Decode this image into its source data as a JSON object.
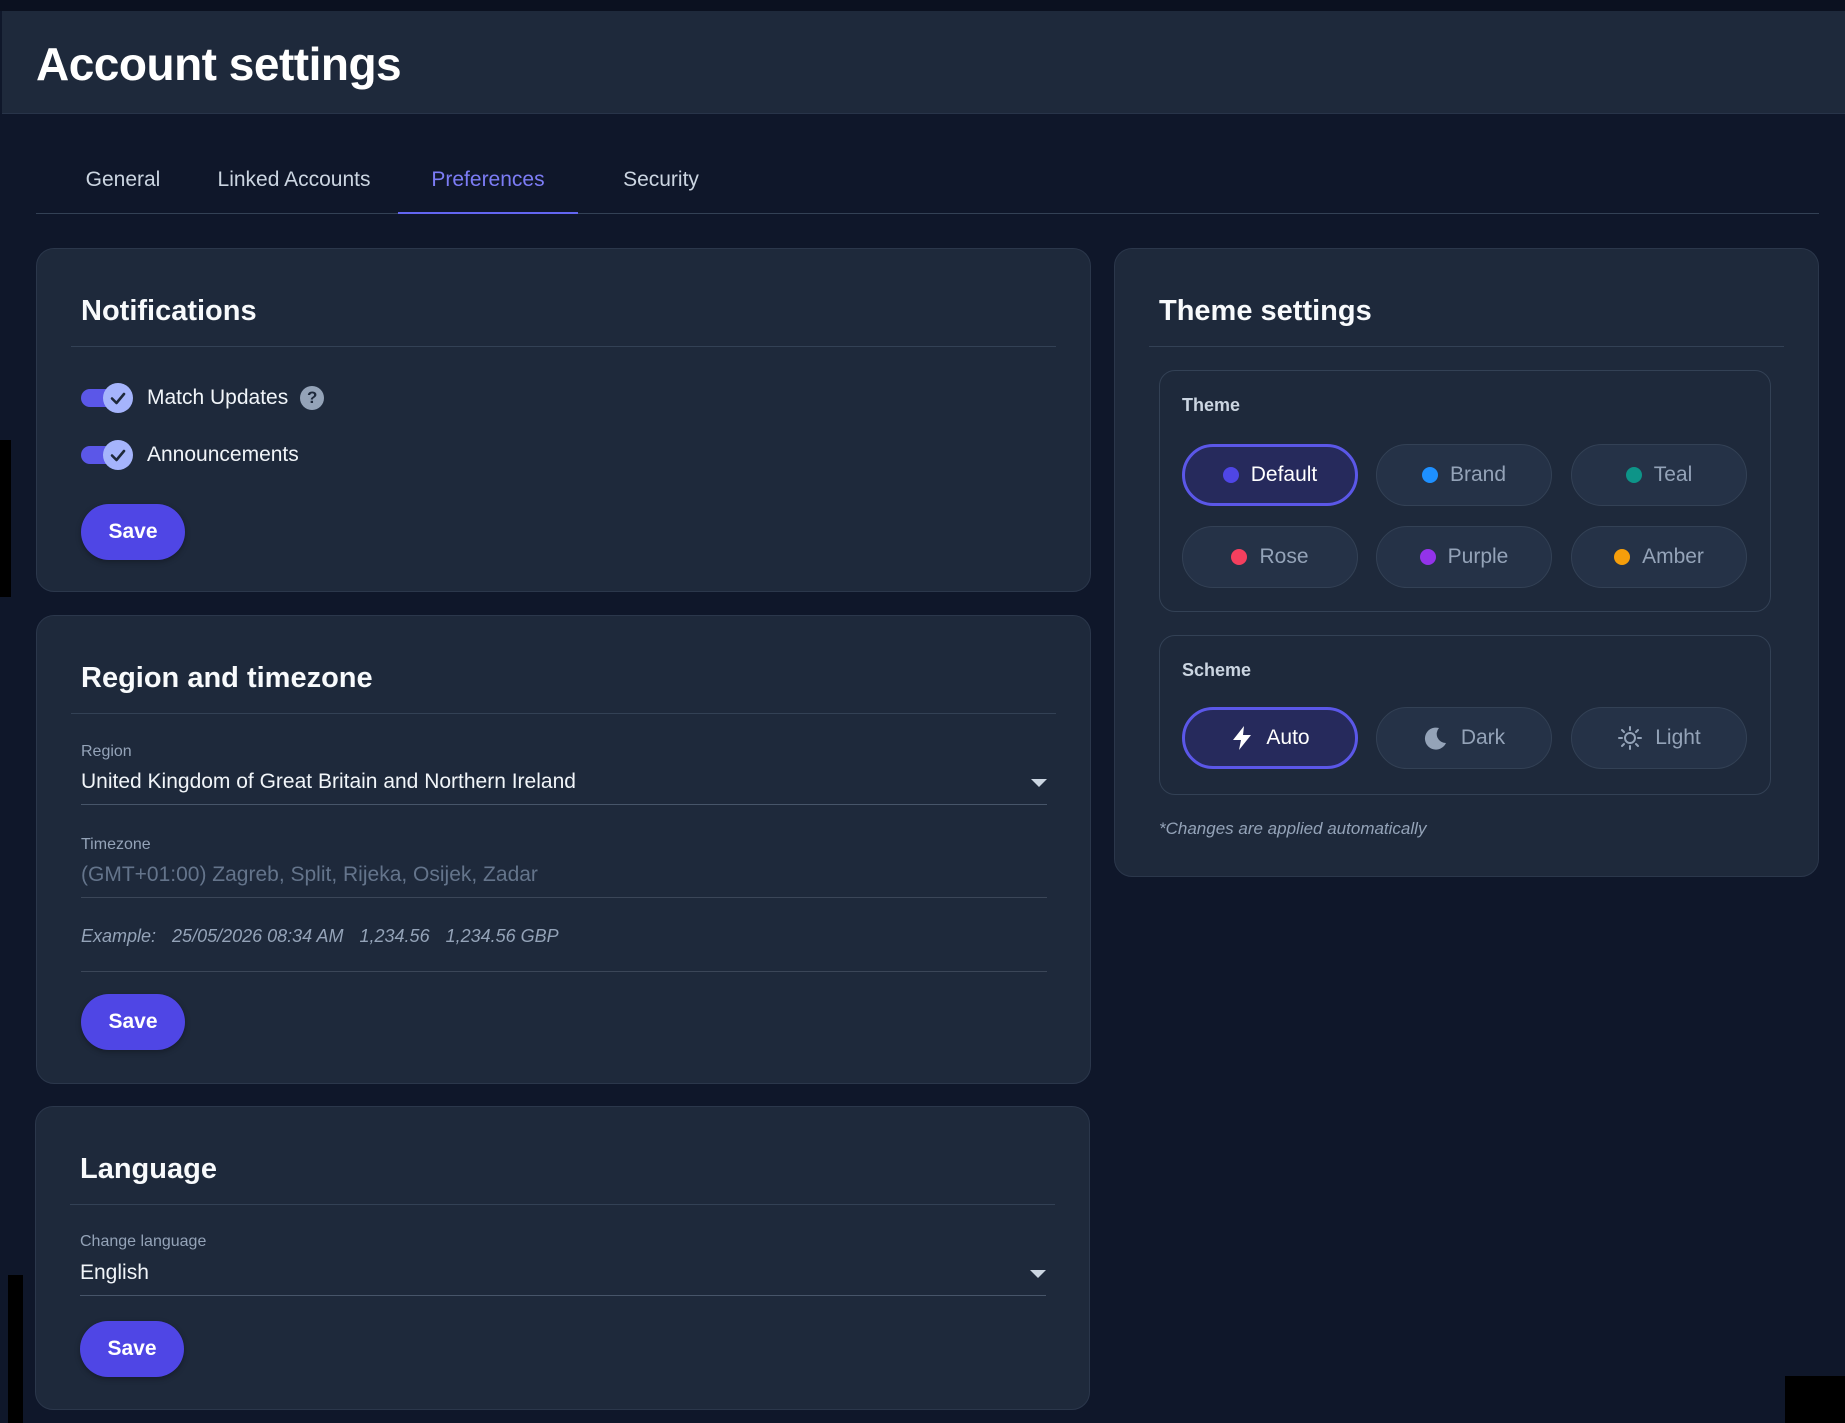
{
  "page": {
    "title": "Account settings"
  },
  "tabs": [
    {
      "label": "General",
      "active": false
    },
    {
      "label": "Linked Accounts",
      "active": false
    },
    {
      "label": "Preferences",
      "active": true
    },
    {
      "label": "Security",
      "active": false
    }
  ],
  "notifications": {
    "title": "Notifications",
    "toggles": [
      {
        "label": "Match Updates",
        "checked": true,
        "help_icon": "question-circle-icon"
      },
      {
        "label": "Announcements",
        "checked": true
      }
    ],
    "save_label": "Save"
  },
  "region": {
    "title": "Region and timezone",
    "region_label": "Region",
    "region_value": "United Kingdom of Great Britain and Northern Ireland",
    "timezone_label": "Timezone",
    "timezone_value": "(GMT+01:00) Zagreb, Split, Rijeka, Osijek, Zadar",
    "example_label": "Example:",
    "example_date": "25/05/2026 08:34 AM",
    "example_number": "1,234.56",
    "example_currency": "1,234.56 GBP",
    "save_label": "Save"
  },
  "language": {
    "title": "Language",
    "field_label": "Change language",
    "field_value": "English",
    "save_label": "Save"
  },
  "theme": {
    "title": "Theme settings",
    "theme_label": "Theme",
    "options": [
      {
        "label": "Default",
        "color": "#4f46e5",
        "selected": true
      },
      {
        "label": "Brand",
        "color": "#1e90ff",
        "selected": false
      },
      {
        "label": "Teal",
        "color": "#0d9488",
        "selected": false
      },
      {
        "label": "Rose",
        "color": "#f43f5e",
        "selected": false
      },
      {
        "label": "Purple",
        "color": "#9333ea",
        "selected": false
      },
      {
        "label": "Amber",
        "color": "#f59e0b",
        "selected": false
      }
    ],
    "scheme_label": "Scheme",
    "schemes": [
      {
        "label": "Auto",
        "icon": "lightning-icon",
        "selected": true
      },
      {
        "label": "Dark",
        "icon": "moon-icon",
        "selected": false
      },
      {
        "label": "Light",
        "icon": "sun-icon",
        "selected": false
      }
    ],
    "note": "*Changes are applied automatically"
  }
}
